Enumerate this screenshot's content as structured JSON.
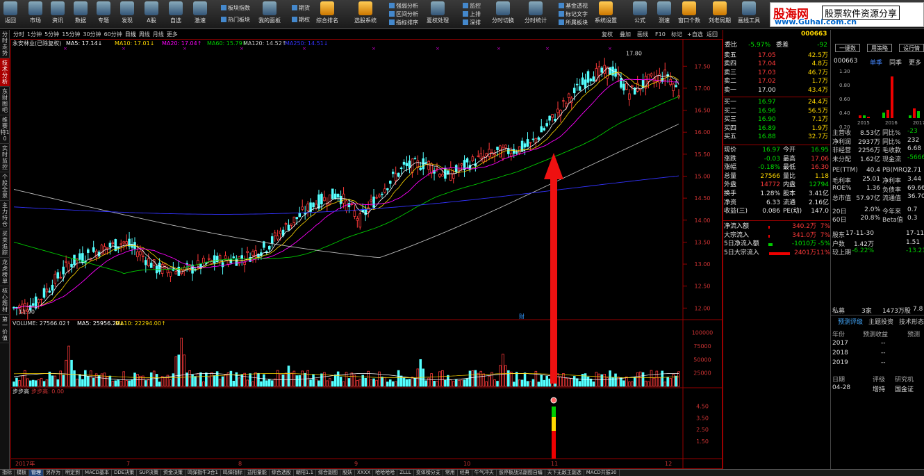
{
  "toolbar": {
    "items": [
      "返回",
      "市场",
      "资讯",
      "数据",
      "专题",
      "发现",
      "A股",
      "自选",
      "激速",
      "我的面板",
      "综合排名",
      "选股系统",
      "夏权处理",
      "分时切换",
      "分时统计",
      "系统设置",
      "公式",
      "测速",
      "窗口个数",
      "刘老局期",
      "画线工具"
    ],
    "sub": {
      "s1": "板块指数",
      "s2": "热门板块",
      "s3": "期货",
      "s4": "期权",
      "s5": "强弱分析",
      "s6": "区间分析",
      "s7": "指标排序",
      "s8": "监控",
      "s9": "上排",
      "s10": "深排",
      "s11": "基金透视",
      "s12": "标记文字",
      "s13": "所属板块"
    }
  },
  "brand": {
    "name": "股海网",
    "slogan": "股票软件资源分享",
    "url": "www.Guhai.com.cn"
  },
  "left_tabs": [
    "分时走势",
    "技术分析",
    "东财图吧",
    "维赛特10",
    "实时监控",
    "个股全景",
    "主力持仓",
    "买卖追踪",
    "龙虎榜单",
    "核心题材",
    "第一价值"
  ],
  "period_tabs": [
    "分时",
    "1分钟",
    "5分钟",
    "15分钟",
    "30分钟",
    "60分钟",
    "日线",
    "周线",
    "月线",
    "更多"
  ],
  "right_tools": [
    "复权",
    "叠加",
    "画线",
    "F10",
    "标记",
    "+自选",
    "返回"
  ],
  "ma_line": {
    "name": "永安林业(已除复权)",
    "ma5": "MA5: 17.14↓",
    "ma10": "MA10: 17.01↓",
    "ma20": "MA20: 17.04↑",
    "ma60": "MA60: 15.79↑",
    "ma120": "MA120: 14.52↑",
    "ma250": "MA250: 14.51↓"
  },
  "vol_line": {
    "vol": "VOLUME: 27566.02↑",
    "ma5": "MA5: 25956.20↓",
    "ma10": "MA10: 22294.00↑"
  },
  "ind_line": {
    "name": "步步高",
    "val": "步步高: 0.00"
  },
  "price_axis": [
    "17.50",
    "17.00",
    "16.50",
    "16.00",
    "15.50",
    "15.00",
    "14.50",
    "14.00",
    "13.50",
    "13.00",
    "12.50",
    "12.00"
  ],
  "vol_axis": [
    "100000",
    "75000",
    "50000",
    "25000"
  ],
  "ind_axis": [
    "4.50",
    "3.50",
    "2.50",
    "1.50"
  ],
  "date_axis": [
    "2017年",
    "7",
    "8",
    "9",
    "10",
    "11",
    "12"
  ],
  "annot": {
    "hi": "17.80",
    "lo": "11.90",
    "mark": "财"
  },
  "quote": {
    "code": "000663",
    "weibi": "委比",
    "weibi_v": "-5.97%",
    "weicha": "委差",
    "weicha_v": "-92",
    "sell": [
      [
        "卖五",
        "17.05",
        "42.5万"
      ],
      [
        "卖四",
        "17.04",
        "4.8万"
      ],
      [
        "卖三",
        "17.03",
        "46.7万"
      ],
      [
        "卖二",
        "17.02",
        "1.7万"
      ],
      [
        "卖一",
        "17.00",
        "43.4万"
      ]
    ],
    "buy": [
      [
        "买一",
        "16.97",
        "24.4万"
      ],
      [
        "买二",
        "16.96",
        "56.5万"
      ],
      [
        "买三",
        "16.90",
        "7.1万"
      ],
      [
        "买四",
        "16.89",
        "1.9万"
      ],
      [
        "买五",
        "16.88",
        "32.7万"
      ]
    ],
    "stats": [
      [
        "现价",
        "16.97",
        "今开",
        "16.95"
      ],
      [
        "涨跌",
        "-0.03",
        "最高",
        "17.06"
      ],
      [
        "涨幅",
        "-0.18%",
        "最低",
        "16.30"
      ],
      [
        "总量",
        "27566",
        "量比",
        "1.18"
      ],
      [
        "外盘",
        "14772",
        "内盘",
        "12794"
      ],
      [
        "换手",
        "1.28%",
        "股本",
        "3.41亿"
      ],
      [
        "净资",
        "6.33",
        "流通",
        "2.16亿"
      ],
      [
        "收益(三)",
        "0.086",
        "PE(动)",
        "147.0"
      ]
    ],
    "flow": [
      [
        "净流入额",
        "340.2万",
        "7%"
      ],
      [
        "大宗流入",
        "341.0万",
        "7%"
      ],
      [
        "5日净流入额",
        "-1010万",
        "-5%"
      ],
      [
        "5日大宗流入",
        "2401万",
        "11%"
      ]
    ]
  },
  "far": {
    "btns": [
      "一键数",
      "用策略",
      "设行情"
    ],
    "code": "000663",
    "season": "单季",
    "yoy": "同季",
    "more": "更多",
    "bar_axis": [
      "1.30",
      "0.80",
      "0.60",
      "0.40",
      "0.20"
    ],
    "years": [
      "2015",
      "2016",
      "2017"
    ],
    "rows": [
      [
        "主营收",
        "8.53亿",
        "同比%",
        "-23"
      ],
      [
        "净利润",
        "2937万",
        "同比%",
        "232"
      ],
      [
        "非经营",
        "2256万",
        "毛收款",
        "6.68"
      ],
      [
        "未分配",
        "1.62亿",
        "现金流",
        "-5666"
      ],
      [
        "PE(TTM)",
        "40.4",
        "PB(MRQ)",
        "2.71"
      ],
      [
        "毛利率",
        "25.01",
        "净利率",
        "3.44"
      ],
      [
        "ROE%",
        "1.36",
        "负债率",
        "69.66"
      ],
      [
        "总市值",
        "57.97亿",
        "流通值",
        "36.70"
      ],
      [
        "20日",
        "2.0%",
        "今年来",
        "0.7"
      ],
      [
        "60日",
        "20.8%",
        "Beta值",
        "0.3"
      ],
      [
        "股东",
        "17-11-30",
        "",
        "17-11-"
      ],
      [
        "户数",
        "1.42万",
        "",
        "1.51"
      ],
      [
        "较上期",
        "-6.22%",
        "",
        "-13.21"
      ]
    ],
    "private": [
      "私募",
      "3家",
      "1473万股",
      "7.8"
    ],
    "tabs": [
      "预测评级",
      "主题投资",
      "技术形态"
    ],
    "fc_head": [
      "年份",
      "预测收益",
      "预测"
    ],
    "fc": [
      [
        "2017",
        "--"
      ],
      [
        "2018",
        "--"
      ],
      [
        "2019",
        "--"
      ]
    ],
    "rate_head": [
      "日期",
      "评级",
      "研究机"
    ],
    "rate": [
      "04-28",
      "增持",
      "国金证"
    ]
  },
  "bottom": [
    "指标",
    "模板",
    "管理",
    "另存为",
    "明定到",
    "MACD基本",
    "DDE决策",
    "SUP决策",
    "资金决策",
    "鸣弹指牛3合1",
    "鸣弹指标",
    "益阳量能",
    "综合选股",
    "朝阳1.1",
    "综合副图",
    "股妖",
    "XXXX",
    "哈哈哈哈",
    "ZLLL",
    "变体榜分支",
    "常用",
    "经典",
    "牛气冲天",
    "涨停板战法副图自编",
    "天下无敌主副选",
    "MACD共振30"
  ],
  "chart_data": {
    "type": "candlestick",
    "ylim": [
      11.8,
      17.9
    ],
    "ticks": [
      17.5,
      17.0,
      16.5,
      16.0,
      15.5,
      15.0,
      14.5,
      14.0,
      13.5,
      13.0,
      12.5,
      12.0
    ],
    "anchors": [
      [
        0,
        12.0
      ],
      [
        8,
        12.1
      ],
      [
        20,
        13.0
      ],
      [
        30,
        13.3
      ],
      [
        40,
        13.5
      ],
      [
        45,
        13.3
      ],
      [
        52,
        12.9
      ],
      [
        62,
        12.85
      ],
      [
        72,
        13.05
      ],
      [
        84,
        13.15
      ],
      [
        92,
        13.4
      ],
      [
        100,
        13.9
      ],
      [
        110,
        14.4
      ],
      [
        118,
        14.6
      ],
      [
        126,
        14.0
      ],
      [
        134,
        14.7
      ],
      [
        142,
        15.2
      ],
      [
        150,
        15.3
      ],
      [
        158,
        15.0
      ],
      [
        166,
        15.3
      ],
      [
        174,
        15.5
      ],
      [
        182,
        15.6
      ],
      [
        188,
        15.7
      ],
      [
        196,
        16.3
      ],
      [
        204,
        16.9
      ],
      [
        210,
        17.3
      ],
      [
        218,
        17.4
      ],
      [
        224,
        16.9
      ],
      [
        232,
        17.2
      ],
      [
        238,
        17.3
      ],
      [
        242,
        16.9
      ]
    ],
    "ma120_start": 14.7,
    "ma250_start": 14.3,
    "vol_peaks": [
      [
        20,
        75000
      ],
      [
        60,
        85000
      ],
      [
        61,
        90000
      ],
      [
        100,
        38000
      ],
      [
        148,
        50000
      ],
      [
        178,
        60000
      ]
    ]
  }
}
